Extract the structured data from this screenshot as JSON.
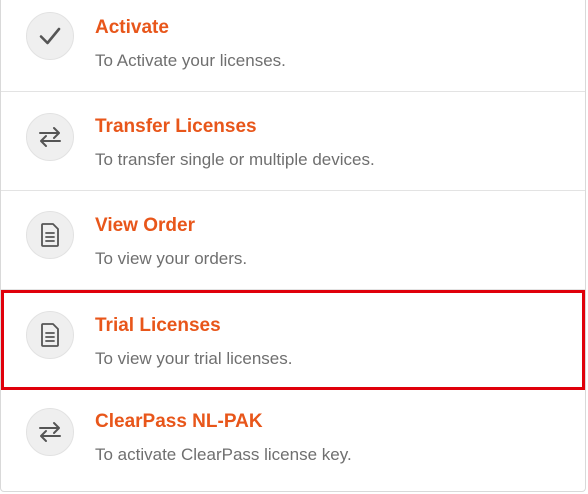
{
  "menu": {
    "items": [
      {
        "title": "Activate",
        "description": "To Activate your licenses.",
        "icon": "checkmark-icon",
        "selected": false
      },
      {
        "title": "Transfer Licenses",
        "description": "To transfer single or multiple devices.",
        "icon": "transfer-arrows-icon",
        "selected": false
      },
      {
        "title": "View Order",
        "description": "To view your orders.",
        "icon": "document-icon",
        "selected": false
      },
      {
        "title": "Trial Licenses",
        "description": "To view your trial licenses.",
        "icon": "document-icon",
        "selected": true
      },
      {
        "title": "ClearPass NL-PAK",
        "description": "To activate ClearPass license key.",
        "icon": "transfer-arrows-icon",
        "selected": false
      }
    ]
  },
  "colors": {
    "title": "#e8561a",
    "description": "#6f6f6f",
    "selection_outline": "#e0000b",
    "icon_background": "#efefef",
    "icon_stroke": "#555555"
  }
}
